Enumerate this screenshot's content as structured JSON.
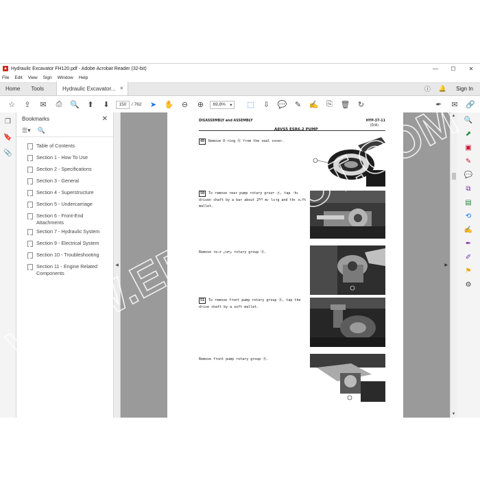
{
  "window": {
    "title": "Hydraulic Excavator FH120.pdf - Adobe Acrobat Reader (32-bit)"
  },
  "menu": [
    "File",
    "Edit",
    "View",
    "Sign",
    "Window",
    "Help"
  ],
  "tabs": {
    "home": "Home",
    "tools": "Tools",
    "document": "Hydraulic Excavator...",
    "signin": "Sign In"
  },
  "toolbar": {
    "current_page": "150",
    "total_pages": "/ 762",
    "zoom": "69,8%"
  },
  "bookmarks": {
    "title": "Bookmarks",
    "items": [
      "Table of Contents",
      "Section 1 - How To Use",
      "Section 2 - Specifications",
      "Section 3 - General",
      "Section 4 - Superstructure",
      "Section 5 - Undercarriage",
      "Section 6 - Front-End Attachments",
      "Section 7 - Hydraulic System",
      "Section 9 - Electrical System",
      "Section 10 - Troubleshooting",
      "Section 11 - Engine Related Components"
    ]
  },
  "page": {
    "header_left": "DISASSEMBLY and ASSEMBLY",
    "header_right": "HYP-37-11",
    "header_sub": "(D/A)",
    "header_center": "A8VS5 ESR6.2 PUMP",
    "steps": [
      {
        "num": "49",
        "text": "Remove O-ring Ⓐ from the seal cover."
      },
      {
        "num": "50",
        "text": "To remove rear pump rotary group Ⓐ, tap the driven shaft by a bar about 250 mm long and the soft mallet."
      },
      {
        "num": "",
        "text": "Remove rear pump rotary group Ⓐ."
      },
      {
        "num": "51",
        "text": "To remove front pump rotary group Ⓐ, tap the drive shaft by a soft mallet."
      },
      {
        "num": "",
        "text": "Remove front pump rotary group Ⓐ."
      }
    ]
  },
  "watermark": "WWW.EPCDEPOT.COM",
  "colors": {
    "accent": "#1473e6",
    "watermark": "#ffffff"
  }
}
